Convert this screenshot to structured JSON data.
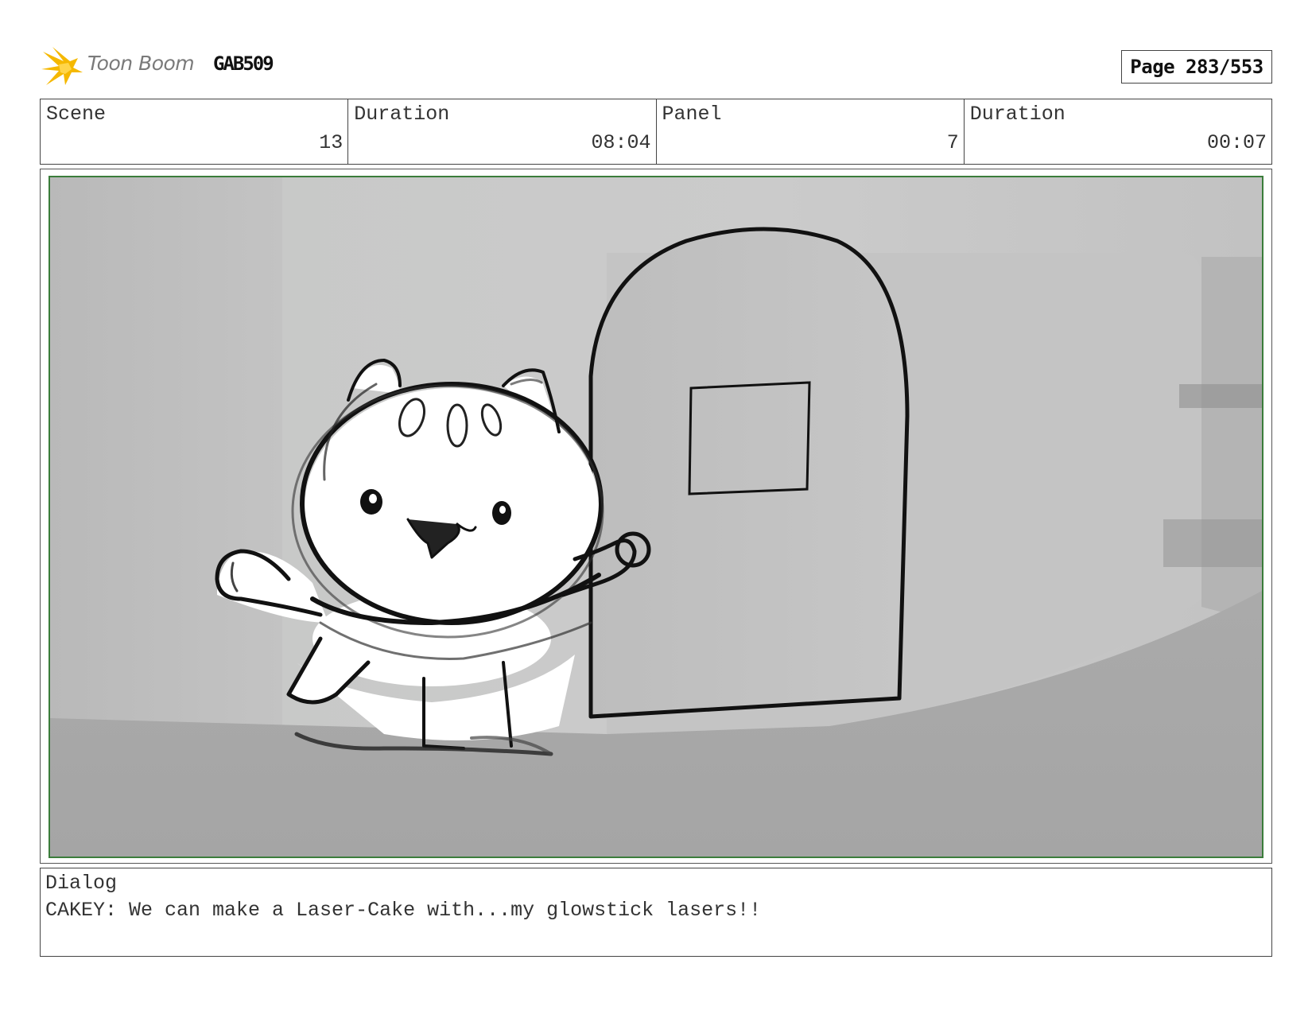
{
  "header": {
    "logo_text": "Toon Boom",
    "project_code": "GAB509",
    "page": "Page 283/553"
  },
  "info": {
    "scene_label": "Scene",
    "scene_value": "13",
    "scene_duration_label": "Duration",
    "scene_duration_value": "08:04",
    "panel_label": "Panel",
    "panel_value": "7",
    "panel_duration_label": "Duration",
    "panel_duration_value": "00:07"
  },
  "dialog": {
    "label": "Dialog",
    "text": "CAKEY: We can make a Laser-Cake with...my glowstick lasers!!"
  },
  "colors": {
    "frame_border": "#3b7d3b",
    "logo_star": "#f5b800",
    "background_wall": "#bcbcbc"
  },
  "icons": {
    "logo": "toon-boom-star-icon"
  }
}
